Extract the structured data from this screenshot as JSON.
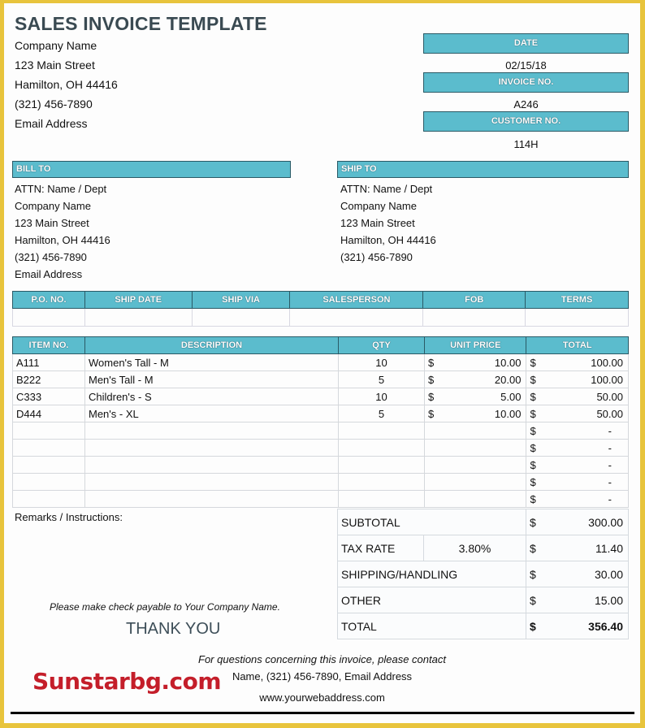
{
  "header": {
    "title": "SALES INVOICE TEMPLATE",
    "company": [
      "Company Name",
      "123 Main Street",
      "Hamilton, OH  44416",
      "(321) 456-7890",
      "Email Address"
    ]
  },
  "meta": {
    "date_label": "DATE",
    "date_value": "02/15/18",
    "invoice_label": "INVOICE NO.",
    "invoice_value": "A246",
    "customer_label": "CUSTOMER NO.",
    "customer_value": "114H"
  },
  "bill_to": {
    "label": "BILL TO",
    "lines": [
      "ATTN: Name / Dept",
      "Company Name",
      "123 Main Street",
      "Hamilton, OH  44416",
      "(321) 456-7890",
      "Email Address"
    ]
  },
  "ship_to": {
    "label": "SHIP TO",
    "lines": [
      "ATTN: Name / Dept",
      "Company Name",
      "123 Main Street",
      "Hamilton, OH  44416",
      "(321) 456-7890"
    ]
  },
  "shipping_table": {
    "headers": [
      "P.O. NO.",
      "SHIP DATE",
      "SHIP VIA",
      "SALESPERSON",
      "FOB",
      "TERMS"
    ],
    "values": [
      "",
      "",
      "",
      "",
      "",
      ""
    ]
  },
  "items_table": {
    "headers": [
      "ITEM NO.",
      "DESCRIPTION",
      "QTY",
      "UNIT PRICE",
      "TOTAL"
    ],
    "currency": "$",
    "rows": [
      {
        "item": "A111",
        "desc": "Women's Tall - M",
        "qty": "10",
        "price": "10.00",
        "total": "100.00"
      },
      {
        "item": "B222",
        "desc": "Men's Tall - M",
        "qty": "5",
        "price": "20.00",
        "total": "100.00"
      },
      {
        "item": "C333",
        "desc": "Children's - S",
        "qty": "10",
        "price": "5.00",
        "total": "50.00"
      },
      {
        "item": "D444",
        "desc": "Men's - XL",
        "qty": "5",
        "price": "10.00",
        "total": "50.00"
      },
      {
        "item": "",
        "desc": "",
        "qty": "",
        "price": "",
        "total": "-"
      },
      {
        "item": "",
        "desc": "",
        "qty": "",
        "price": "",
        "total": "-"
      },
      {
        "item": "",
        "desc": "",
        "qty": "",
        "price": "",
        "total": "-"
      },
      {
        "item": "",
        "desc": "",
        "qty": "",
        "price": "",
        "total": "-"
      },
      {
        "item": "",
        "desc": "",
        "qty": "",
        "price": "",
        "total": "-"
      }
    ]
  },
  "totals": {
    "subtotal_label": "SUBTOTAL",
    "subtotal": "300.00",
    "tax_label": "TAX RATE",
    "tax_rate": "3.80%",
    "tax": "11.40",
    "shipping_label": "SHIPPING/HANDLING",
    "shipping": "30.00",
    "other_label": "OTHER",
    "other": "15.00",
    "total_label": "TOTAL",
    "total": "356.40",
    "currency": "$"
  },
  "remarks_label": "Remarks / Instructions:",
  "check_note": "Please make check payable to Your Company Name.",
  "thank_you": "THANK YOU",
  "footer": {
    "question": "For questions concerning this invoice, please contact",
    "contact": "Name, (321) 456-7890, Email Address",
    "website": "www.yourwebaddress.com"
  },
  "watermark": "Sunstarbg.com",
  "colors": {
    "header_teal": "#5bbccd",
    "border_gold": "#e8c43c",
    "watermark_red": "#c41e2a"
  }
}
